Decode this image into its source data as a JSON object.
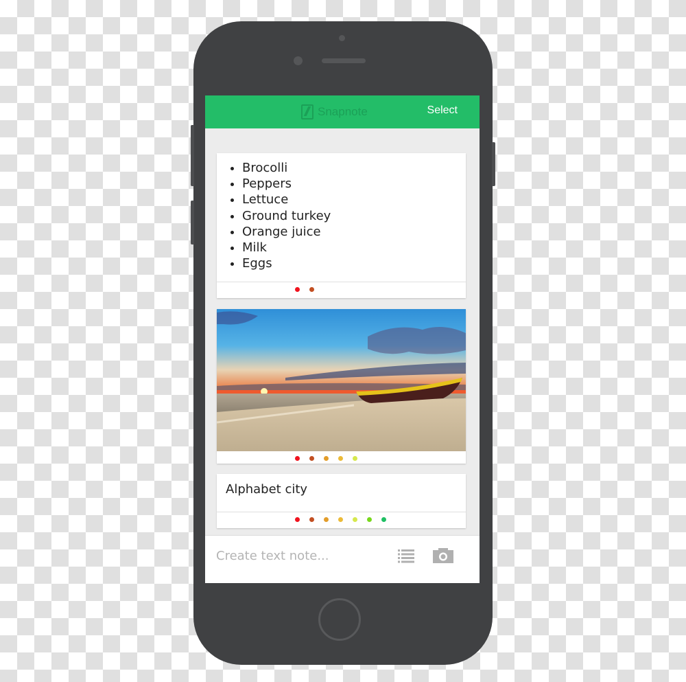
{
  "app": {
    "brand_name": "Snapnote",
    "select_label": "Select",
    "brand_color": "#23bd68"
  },
  "notes": [
    {
      "type": "list",
      "items": [
        "Brocolli",
        "Peppers",
        "Lettuce",
        "Ground turkey",
        "Orange juice",
        "Milk",
        "Eggs"
      ],
      "color_dots": [
        "#f0131e",
        "#c24f22"
      ]
    },
    {
      "type": "image",
      "image_description": "Sunset beach with yellow wooden boat",
      "color_dots": [
        "#f0131e",
        "#c24f22",
        "#e39d2a",
        "#ecbb38",
        "#d6e84d"
      ]
    },
    {
      "type": "text",
      "title": "Alphabet city",
      "color_dots": [
        "#f0131e",
        "#c24f22",
        "#e39d2a",
        "#ecbb38",
        "#d6e84d",
        "#78d81c",
        "#1fbf63"
      ]
    }
  ],
  "composer": {
    "placeholder": "Create text note...",
    "list_icon": "checklist-icon",
    "camera_icon": "camera-icon"
  }
}
